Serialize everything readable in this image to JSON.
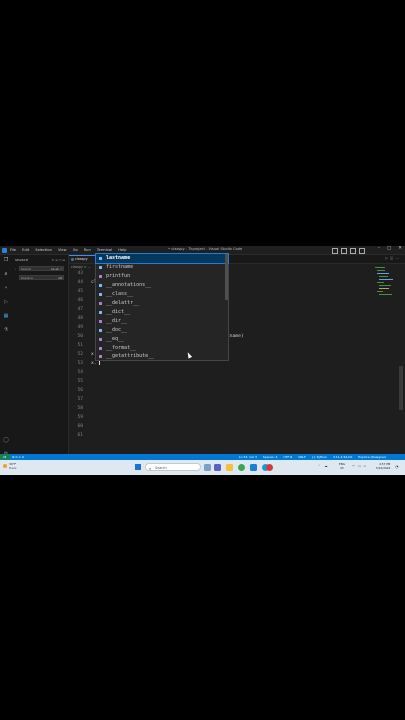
{
  "window": {
    "title": "• classpy - Tkproject - Visual Studio Code",
    "menu": [
      "File",
      "Edit",
      "Selection",
      "View",
      "Go",
      "Run",
      "Terminal",
      "Help"
    ]
  },
  "sidebar": {
    "header": "SEARCH",
    "search_placeholder": "Search",
    "replace_placeholder": "Replace",
    "search_options": "Aa ab .*",
    "replace_options": "AB"
  },
  "editor": {
    "tab_label": "classpy",
    "breadcrumb": "classpy > ...",
    "line_numbers": [
      "43",
      "44",
      "45",
      "46",
      "47",
      "48",
      "49",
      "50",
      "51",
      "52",
      "53",
      "54",
      "55",
      "56",
      "57",
      "58",
      "59",
      "60",
      "61"
    ],
    "visible_code": {
      "line_44": "cl",
      "line_49": "tname)",
      "line_52": "x",
      "line_53": "x."
    }
  },
  "suggestions": {
    "items": [
      {
        "label": "lastname",
        "kind": "variable",
        "selected": true
      },
      {
        "label": "firstname",
        "kind": "variable",
        "selected": false
      },
      {
        "label": "printfun",
        "kind": "method",
        "selected": false
      },
      {
        "label": "__annotations__",
        "kind": "variable",
        "selected": false
      },
      {
        "label": "__class__",
        "kind": "variable",
        "selected": false
      },
      {
        "label": "__delattr__",
        "kind": "method",
        "selected": false
      },
      {
        "label": "__dict__",
        "kind": "variable",
        "selected": false
      },
      {
        "label": "__dir__",
        "kind": "method",
        "selected": false
      },
      {
        "label": "__doc__",
        "kind": "variable",
        "selected": false
      },
      {
        "label": "__eq__",
        "kind": "method",
        "selected": false
      },
      {
        "label": "__format__",
        "kind": "method",
        "selected": false
      },
      {
        "label": "__getattribute__",
        "kind": "method",
        "selected": false
      }
    ]
  },
  "statusbar": {
    "left": "⊗ 0 ⚠ 0",
    "items": [
      "Ln 53, Col 3",
      "Spaces: 4",
      "UTF-8",
      "CRLF",
      "{} Python",
      "3.11.4 64-bit",
      "Explore (Designer)"
    ]
  },
  "taskbar": {
    "weather_temp": "30°F",
    "weather_desc": "Haze",
    "search_placeholder": "Search",
    "lang": "ENG",
    "lang_sub": "IN",
    "time": "4:57 PM",
    "date": "5/10/2024"
  },
  "colors": {
    "accent": "#0078d4",
    "editor_bg": "#1e1e1e",
    "selection": "#04395e"
  }
}
